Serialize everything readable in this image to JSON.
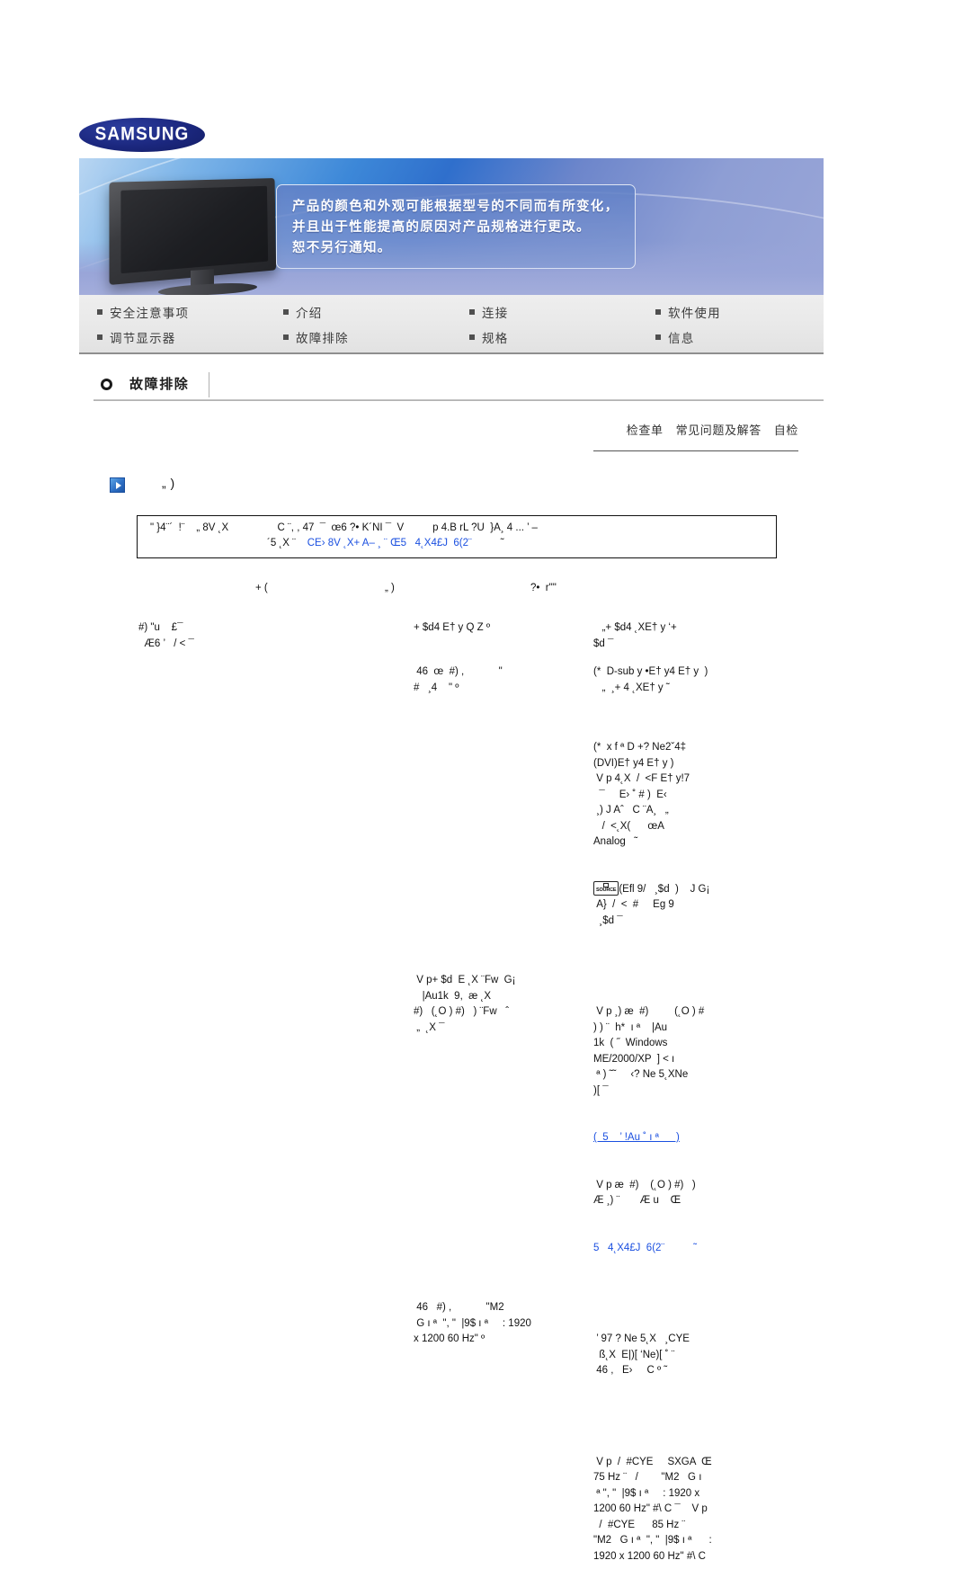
{
  "brand": {
    "name": "SAMSUNG"
  },
  "banner": {
    "notice_lines": [
      "产品的颜色和外观可能根据型号的不同而有所变化，",
      "并且出于性能提高的原因对产品规格进行更改。",
      "恕不另行通知。"
    ]
  },
  "nav": {
    "items": [
      {
        "label": "安全注意事项"
      },
      {
        "label": "介绍"
      },
      {
        "label": "连接"
      },
      {
        "label": "软件使用"
      },
      {
        "label": "调节显示器"
      },
      {
        "label": "故障排除"
      },
      {
        "label": "规格"
      },
      {
        "label": "信息"
      }
    ]
  },
  "section": {
    "title": "故障排除"
  },
  "tabs": [
    {
      "label": "检查单"
    },
    {
      "label": "常见问题及解答"
    },
    {
      "label": "自检"
    }
  ],
  "subhead": {
    "text": "„ )"
  },
  "notebox": {
    "line1": "\" }4¨´  !¨    „ 8V ˛X                 C ¨, , 47  ¯  œ6 ?• K´NI ¯  V          p 4.B rL ?U  }A¸ 4 ... ’ –",
    "line2_prefix": "´5 ˛X ¨    ",
    "line2_link": "CE› 8V ˛X+ A– ¸ ¨ Œ5   4˛X4£J  6(2¨",
    "line2_suffix": "          ˜"
  },
  "table": {
    "headers": [
      "+ (",
      "„ )",
      "?•  r\"\""
    ],
    "rows": [
      {
        "c1": "#) \"u    £¯\n  Æ6 ’   / < ¯",
        "c2_blocks": [
          "+ $d4 E† y Q Z º"
        ],
        "c3_blocks": [
          "   „+ $d4 ˛XE† y ‘+\n$d ¯"
        ]
      },
      {
        "c1": "",
        "c2_blocks": [
          " 46  œ  #) ,            \"\n#   ¸4    \" º"
        ],
        "c3_blocks": [
          "(*  D-sub y •E† y4 E† y  )\n   „  ¸+ 4 ˛XE† y ˜"
        ]
      },
      {
        "c1": "",
        "c2_blocks": [],
        "c3_blocks": [
          "(*  x f ª D +? Ne2ˇ4‡\n(DVI)E† y4 E† y )\n V p 4˛X  /  <F E† y!7\n  ¯     E› ˚ # )  E‹\n ¸) J Aˆ   C ¨A¸   „\n   /  <˛X(      œA\nAnalog   ˜",
          "(Efl 9/   ¸$d  )    J G¡\n A}  /  <  #     Eg 9\n  ¸$d ¯"
        ]
      },
      {
        "c1": "",
        "c2_blocks": [
          " V p+ $d  E ˛X ¨Fw  G¡\n   |Au1k  9,  æ ˛X\n#)   (˛O ) #)   ) ¨Fw   ˆ\n „  ˛X ¯"
        ],
        "c3_blocks": [
          " V p ¸) æ  #)         (˛O ) #\n) ) ¨  h*  ı ª    |Au\n1k  ( ˝  Windows\nME/2000/XP  ] < ı\n ª ) ˜˜     ‹? Ne 5˛XNe\n)[ ¯",
          "LINK:(  5    ’ !Au ˚ ı ª      )",
          " V p æ  #)    (˛O ) #)   )\nÆ ¸) ¨       Æ u    Œ"
        ],
        "c3_link2": "5   4˛X4£J  6(2¨          ˜"
      },
      {
        "c1": "",
        "c2_blocks": [
          " 46   #) ,            \"M2\n G ı ª  \", \"  |9$ ı ª     : 1920\nx 1200 60 Hz\" º"
        ],
        "c3_blocks": [
          " ’ 97 ? Ne 5˛X   ¸CYE\n  ß˛X  E|)[ ‘Ne)[ ˚ ¨\n 46 ,   E›     C º ˜",
          " V p  /  #CYE     SXGA  Œ\n75 Hz ¨   /        \"M2   G ı\n ª \", \"  |9$ ı ª     : 1920 x\n1200 60 Hz\" #\\ C ¯    V p\n  /  #CYE      85 Hz ¨\n\"M2   G ı ª  \", \"  |9$ ı ª      :\n1920 x 1200 60 Hz\" #\\ C"
        ]
      }
    ]
  }
}
